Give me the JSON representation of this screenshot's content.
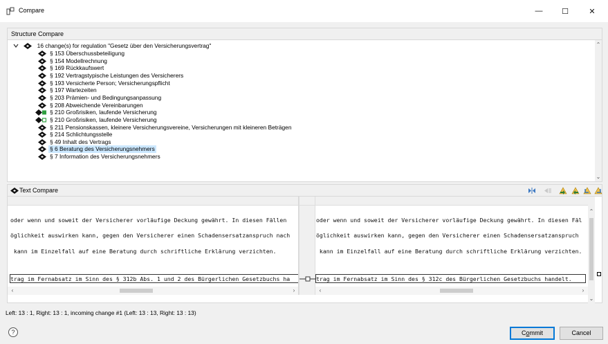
{
  "window": {
    "title": "Compare",
    "minimize": "—",
    "maximize": "☐",
    "close": "✕"
  },
  "structure": {
    "header": "Structure Compare",
    "root_label": "16 change(s) for regulation \"Gesetz über den Versicherungsvertrag\"",
    "items": [
      {
        "label": "§ 153 Überschussbeteiligung",
        "icon": "diamond-change-icon",
        "selected": false
      },
      {
        "label": "§ 154 Modellrechnung",
        "icon": "diamond-change-icon",
        "selected": false
      },
      {
        "label": "§ 169 Rückkaufswert",
        "icon": "diamond-change-icon",
        "selected": false
      },
      {
        "label": "§ 192 Vertragstypische Leistungen des Versicherers",
        "icon": "diamond-change-icon",
        "selected": false
      },
      {
        "label": "§ 193 Versicherte Person; Versicherungspflicht",
        "icon": "diamond-change-icon",
        "selected": false
      },
      {
        "label": "§ 197 Wartezeiten",
        "icon": "diamond-change-icon",
        "selected": false
      },
      {
        "label": "§ 203 Prämien- und Bedingungsanpassung",
        "icon": "diamond-change-icon",
        "selected": false
      },
      {
        "label": "§ 208 Abweichende Vereinbarungen",
        "icon": "diamond-change-icon",
        "selected": false
      },
      {
        "label": "§ 210 Großrisiken, laufende Versicherung",
        "icon": "diamond-add-icon",
        "selected": false
      },
      {
        "label": "§ 210 Großrisiken, laufende Versicherung",
        "icon": "diamond-add-outline-icon",
        "selected": false
      },
      {
        "label": "§ 211 Pensionskassen, kleinere Versicherungsvereine, Versicherungen mit kleineren Beträgen",
        "icon": "diamond-change-icon",
        "selected": false
      },
      {
        "label": "§ 214 Schlichtungsstelle",
        "icon": "diamond-change-icon",
        "selected": false
      },
      {
        "label": "§ 49 Inhalt des Vertrags",
        "icon": "diamond-change-icon",
        "selected": false
      },
      {
        "label": "§ 6 Beratung des Versicherungsnehmers",
        "icon": "diamond-change-icon",
        "selected": true
      },
      {
        "label": "§ 7 Information des Versicherungsnehmers",
        "icon": "diamond-change-icon",
        "selected": false
      }
    ]
  },
  "text_compare": {
    "header": "Text Compare",
    "toolbar": [
      "next-difference-icon",
      "previous-difference-icon",
      "copy-left-to-right-icon",
      "copy-right-to-left-icon",
      "next-change-icon",
      "previous-change-icon"
    ],
    "left_lines": [
      "oder wenn und soweit der Versicherer vorläufige Deckung gewährt. In diesen Fällen",
      "öglichkeit auswirken kann, gegen den Versicherer einen Schadensersatzanspruch nach",
      " kann im Einzelfall auf eine Beratung durch schriftliche Erklärung verzichten.",
      "trag im Fernabsatz im Sinn des § 312b Abs. 1 und 2 des Bürgerlichen Gesetzbuchs ha"
    ],
    "right_lines": [
      "oder wenn und soweit der Versicherer vorläufige Deckung gewährt. In diesen Fäl",
      "öglichkeit auswirken kann, gegen den Versicherer einen Schadensersatzanspruch",
      " kann im Einzelfall auf eine Beratung durch schriftliche Erklärung verzichten.",
      "trag im Fernabsatz im Sinn des § 312c des Bürgerlichen Gesetzbuchs handelt."
    ]
  },
  "status": "Left: 13 : 1, Right: 13 : 1, incoming change #1 (Left: 13 : 13, Right: 13 : 13)",
  "buttons": {
    "commit": "Commit",
    "commit_underlined": "o",
    "cancel": "Cancel",
    "help": "?"
  },
  "colors": {
    "selection": "#cce8ff",
    "diff_border": "#333333",
    "default_button_border": "#0078d7",
    "added_marker": "#2e9e3e"
  }
}
